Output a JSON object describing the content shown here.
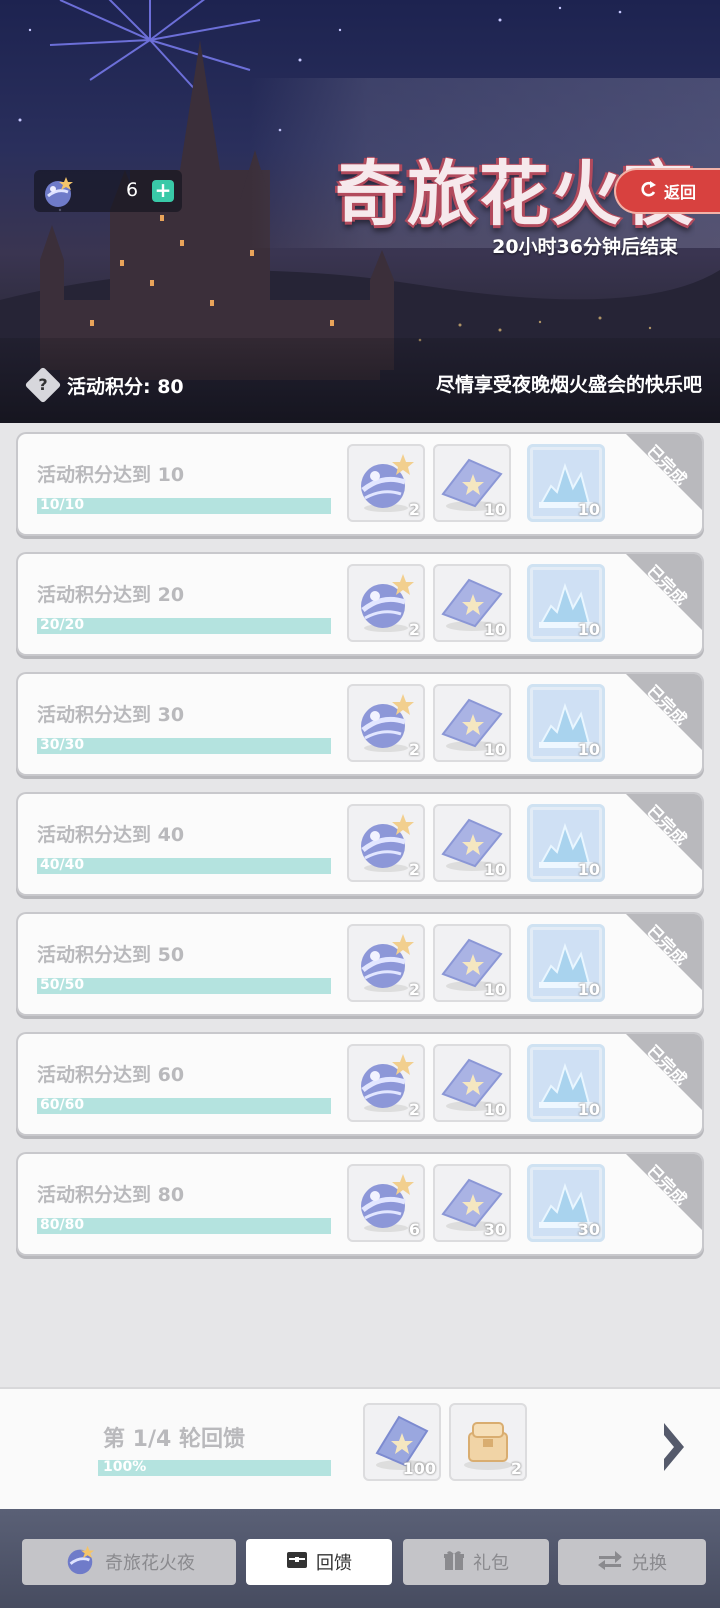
{
  "header": {
    "event_title": "奇旅花火夜",
    "timer": "20小时36分钟后结束",
    "back_label": "返回",
    "currency": {
      "icon": "firework-bomb-icon",
      "count": "6",
      "add_icon": "plus-icon"
    },
    "score_label": "活动积分: 80",
    "slogan": "尽情享受夜晚烟火盛会的快乐吧"
  },
  "tasks": [
    {
      "label": "活动积分达到 10",
      "progress": "10/10",
      "progress_fraction": 1.0,
      "status": "已完成",
      "rewards": [
        "2",
        "10",
        "10"
      ]
    },
    {
      "label": "活动积分达到 20",
      "progress": "20/20",
      "progress_fraction": 1.0,
      "status": "已完成",
      "rewards": [
        "2",
        "10",
        "10"
      ]
    },
    {
      "label": "活动积分达到 30",
      "progress": "30/30",
      "progress_fraction": 1.0,
      "status": "已完成",
      "rewards": [
        "2",
        "10",
        "10"
      ]
    },
    {
      "label": "活动积分达到 40",
      "progress": "40/40",
      "progress_fraction": 1.0,
      "status": "已完成",
      "rewards": [
        "2",
        "10",
        "10"
      ]
    },
    {
      "label": "活动积分达到 50",
      "progress": "50/50",
      "progress_fraction": 1.0,
      "status": "已完成",
      "rewards": [
        "2",
        "10",
        "10"
      ]
    },
    {
      "label": "活动积分达到 60",
      "progress": "60/60",
      "progress_fraction": 1.0,
      "status": "已完成",
      "rewards": [
        "2",
        "10",
        "10"
      ]
    },
    {
      "label": "活动积分达到 80",
      "progress": "80/80",
      "progress_fraction": 1.0,
      "status": "已完成",
      "rewards": [
        "6",
        "30",
        "30"
      ]
    }
  ],
  "reward_icons": [
    "firework-bomb-icon",
    "star-ticket-icon",
    "ice-crystal-icon"
  ],
  "round": {
    "label": "第 1/4 轮回馈",
    "progress": "100%",
    "progress_fraction": 1.0,
    "rewards": [
      {
        "icon": "star-ticket-icon",
        "qty": "100"
      },
      {
        "icon": "treasure-box-icon",
        "qty": "2"
      }
    ],
    "next_icon": "chevron-right-icon"
  },
  "nav": [
    {
      "label": "奇旅花火夜",
      "icon": "firework-bomb-icon",
      "active": false
    },
    {
      "label": "回馈",
      "icon": "chest-icon",
      "active": true
    },
    {
      "label": "礼包",
      "icon": "gift-icon",
      "active": false
    },
    {
      "label": "兑换",
      "icon": "exchange-icon",
      "active": false
    }
  ],
  "colors": {
    "accent_red": "#d8413f",
    "progress_fill": "#b4e3df",
    "plus_green": "#39c9a8",
    "completed_ribbon": "#b9b9bd"
  }
}
